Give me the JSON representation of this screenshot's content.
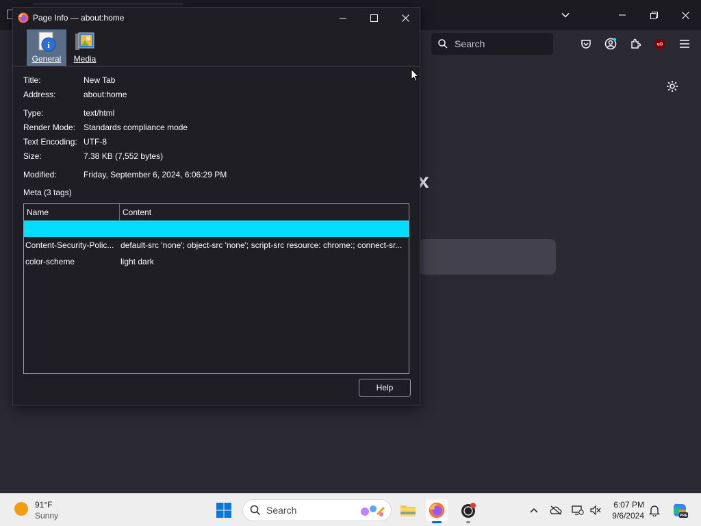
{
  "dialog": {
    "title": "Page Info — about:home",
    "tabs": [
      {
        "label": "General",
        "icon": "info-icon",
        "active": true
      },
      {
        "label": "Media",
        "icon": "media-icon",
        "active": false
      }
    ],
    "fields": [
      {
        "label": "Title:",
        "value": "New Tab"
      },
      {
        "label": "Address:",
        "value": "about:home"
      },
      {
        "label": "Type:",
        "value": "text/html"
      },
      {
        "label": "Render Mode:",
        "value": "Standards compliance mode"
      },
      {
        "label": "Text Encoding:",
        "value": "UTF-8"
      },
      {
        "label": "Size:",
        "value": "7.38 KB (7,552 bytes)"
      },
      {
        "label": "Modified:",
        "value": "Friday, September 6, 2024, 6:06:29 PM"
      }
    ],
    "meta_label": "Meta (3 tags)",
    "meta_columns": [
      "Name",
      "Content"
    ],
    "meta_rows": [
      {
        "name": "",
        "content": "",
        "selected": true
      },
      {
        "name": "Content-Security-Polic...",
        "content": "default-src 'none'; object-src 'none'; script-src resource: chrome:; connect-sr...",
        "selected": false
      },
      {
        "name": "color-scheme",
        "content": "light dark",
        "selected": false
      }
    ],
    "help_label": "Help",
    "selection_color": "#00ddff"
  },
  "browser": {
    "search_placeholder": "Search",
    "logo_fragment": "x"
  },
  "taskbar": {
    "weather_temp": "91°F",
    "weather_desc": "Sunny",
    "search_placeholder": "Search",
    "time": "6:07 PM",
    "date": "9/6/2024"
  }
}
